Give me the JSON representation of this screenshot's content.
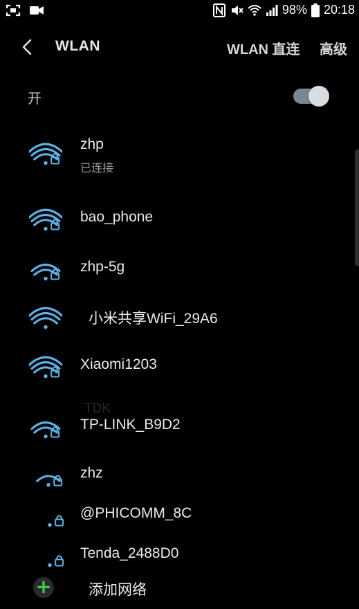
{
  "statusbar": {
    "battery": "98%",
    "time": "20:18",
    "left_icons": [
      "screenshot-icon",
      "video-camera-icon"
    ],
    "right_icons": [
      "nfc-icon",
      "mute-icon",
      "wifi-status-icon",
      "signal-icon",
      "battery-icon"
    ]
  },
  "appbar": {
    "title": "WLAN",
    "direct_label": "WLAN 直连",
    "advanced_label": "高级"
  },
  "toggle": {
    "label": "开",
    "state": "on"
  },
  "networks": [
    {
      "name": "zhp",
      "status": "已连接",
      "strength": 4,
      "locked": true
    },
    {
      "name": "bao_phone",
      "strength": 4,
      "locked": true
    },
    {
      "name": "zhp-5g",
      "strength": 3,
      "locked": true
    },
    {
      "name": "小米共享WiFi_29A6",
      "strength": 4,
      "locked": false
    },
    {
      "name": "Xiaomi1203",
      "strength": 4,
      "locked": true
    },
    {
      "name": "TP-LINK_B9D2",
      "strength": 3,
      "locked": true
    },
    {
      "name": "zhz",
      "strength": 2,
      "locked": true
    },
    {
      "name": "@PHICOMM_8C",
      "strength": 1,
      "locked": true
    },
    {
      "name": "Tenda_2488D0",
      "strength": 1,
      "locked": true
    }
  ],
  "ghost": {
    "name": "TDK"
  },
  "add_network": {
    "label": "添加网络"
  },
  "colors": {
    "wifi": "#5ab4e8",
    "wifi_dim": "#2b3f4d",
    "accent_add": "#3fc94a"
  }
}
